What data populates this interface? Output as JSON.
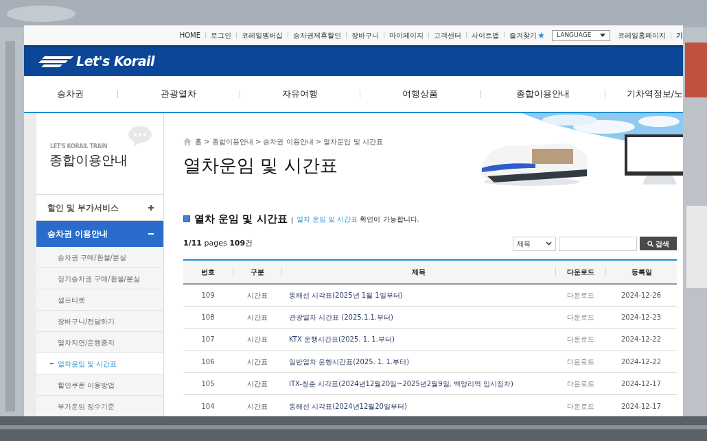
{
  "top_bar": {
    "links": [
      "HOME",
      "로그인",
      "코레일멤버십",
      "승차권제휴할인",
      "장바구니",
      "마이페이지",
      "고객센터",
      "사이트맵"
    ],
    "favorites": "즐겨찾기",
    "language": "LANGUAGE",
    "home_link": "코레일홈페이지",
    "cut_link": "기"
  },
  "logo": "Let's Korail",
  "nav": [
    "승차권",
    "관광열차",
    "자유여행",
    "여행상품",
    "종합이용안내",
    "기차역정보/노"
  ],
  "sidebar": {
    "caption": "LET'S KORAIL TRAIN",
    "title": "종합이용안내",
    "menu": [
      {
        "label": "할인 및 부가서비스",
        "expanded": false
      },
      {
        "label": "승차권 이용안내",
        "expanded": true,
        "children": [
          {
            "label": "승차권 구매/환불/분실",
            "selected": false
          },
          {
            "label": "정기승차권 구매/환불/분실",
            "selected": false
          },
          {
            "label": "셀프티켓",
            "selected": false
          },
          {
            "label": "장바구니/전달하기",
            "selected": false
          },
          {
            "label": "열차지연/운행중지",
            "selected": false
          },
          {
            "label": "열차운임 및 시간표",
            "selected": true
          },
          {
            "label": "할인쿠폰 이용방법",
            "selected": false
          },
          {
            "label": "부가운임 징수기준",
            "selected": false
          }
        ]
      }
    ]
  },
  "breadcrumb": "홈 > 종합이용안내 > 승차권 이용안내 > 열차운임 및 시간표",
  "page_title": "열차운임 및 시간표",
  "section": {
    "title": "열차 운임 및 시간표",
    "link": "열차 운임 및 시간표",
    "text": "확인이 가능합니다."
  },
  "count": "**1/11** pages **109**건",
  "search": {
    "field": "제목",
    "button": "검색"
  },
  "table": {
    "columns": [
      "번호",
      "구분",
      "제목",
      "다운로드",
      "등록일"
    ],
    "rows": [
      [
        "109",
        "시간표",
        "동해선 시각표(2025년 1월 1일부터)",
        "다운로드",
        "2024-12-26"
      ],
      [
        "108",
        "시간표",
        "관광열차 시간표 (2025.1.1.부터)",
        "다운로드",
        "2024-12-23"
      ],
      [
        "107",
        "시간표",
        "KTX 운행시간표(2025. 1. 1.부터)",
        "다운로드",
        "2024-12-22"
      ],
      [
        "106",
        "시간표",
        "일반열차 운행시간표(2025. 1. 1.부터)",
        "다운로드",
        "2024-12-22"
      ],
      [
        "105",
        "시간표",
        "ITX-청춘 시각표(2024년12월20일~2025년2월9일, 백양리역 임시정차)",
        "다운로드",
        "2024-12-17"
      ],
      [
        "104",
        "시간표",
        "동해선 시각표(2024년12월20일부터)",
        "다운로드",
        "2024-12-17"
      ]
    ]
  }
}
